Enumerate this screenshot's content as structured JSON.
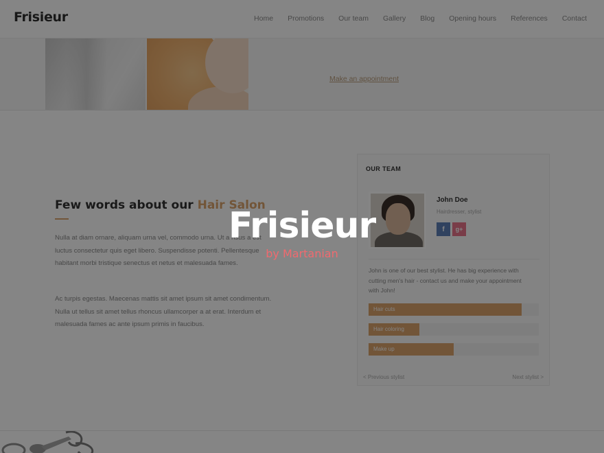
{
  "header": {
    "logo": "Frisieur",
    "nav": [
      {
        "label": "Home"
      },
      {
        "label": "Promotions"
      },
      {
        "label": "Our team"
      },
      {
        "label": "Gallery"
      },
      {
        "label": "Blog"
      },
      {
        "label": "Opening hours"
      },
      {
        "label": "References"
      },
      {
        "label": "Contact"
      }
    ]
  },
  "hero": {
    "link": "Make an appointment"
  },
  "about": {
    "title_prefix": "Few words about our ",
    "title_accent": "Hair Salon",
    "paragraph_1": "Nulla at diam ornare, aliquam urna vel, commodo urna. Ut a risus a est luctus consectetur quis eget libero. Suspendisse potenti. Pellentesque habitant morbi tristique senectus et netus et malesuada fames.",
    "paragraph_2": "Ac turpis egestas. Maecenas mattis sit amet ipsum sit amet condimentum. Nulla ut tellus sit amet tellus rhoncus ullamcorper a at erat. Interdum et malesuada fames ac ante ipsum primis in faucibus."
  },
  "team": {
    "heading": "OUR TEAM",
    "name": "John Doe",
    "role": "Hairdresser, stylist",
    "bio": "John is one of our best stylist. He has big experience with cutting men's hair - contact us and make your appointment with John!",
    "skills": [
      {
        "label": "Hair cuts",
        "value": 0.9
      },
      {
        "label": "Hair coloring",
        "value": 0.3
      },
      {
        "label": "Make up",
        "value": 0.5
      }
    ],
    "prev": "< Previous stylist",
    "next": "Next stylist >",
    "social_fb": "f",
    "social_gp": "g+"
  },
  "overlay": {
    "title": "Frisieur",
    "subtitle": "by Martanian"
  },
  "colors": {
    "accent": "#dba46c",
    "overlay_subtitle": "#f06a6f",
    "facebook": "#5d7fb6",
    "google_plus": "#e8738a"
  }
}
